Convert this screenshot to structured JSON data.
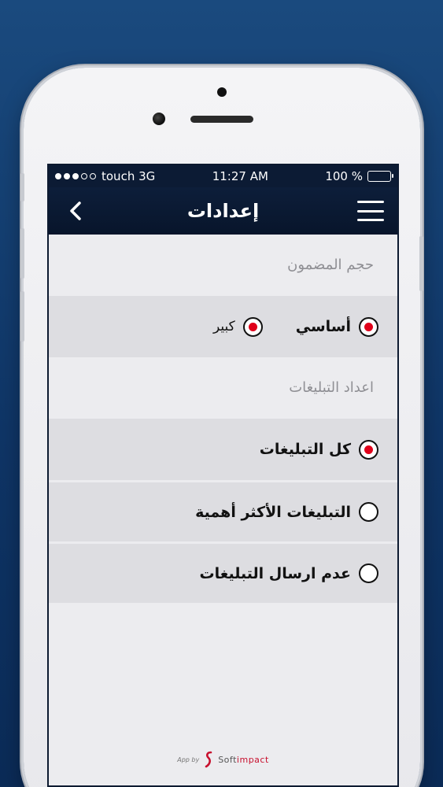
{
  "status_bar": {
    "signal_dots": [
      true,
      true,
      true,
      false,
      false
    ],
    "carrier": "touch 3G",
    "time": "11:27 AM",
    "battery_text": "100 %",
    "battery_level": 100
  },
  "navbar": {
    "title": "إعدادات",
    "back_icon": "chevron-left-icon",
    "menu_icon": "hamburger-menu-icon"
  },
  "content_size": {
    "header": "حجم المضمون",
    "options": [
      {
        "label": "أساسي",
        "selected": true
      },
      {
        "label": "كبير",
        "selected": true
      }
    ]
  },
  "notifications": {
    "header": "اعداد التبليغات",
    "options": [
      {
        "label": "كل التبليغات",
        "selected": true
      },
      {
        "label": "التبليغات الأكثر أهمية",
        "selected": false
      },
      {
        "label": "عدم ارسال التبليغات",
        "selected": false
      }
    ]
  },
  "footer": {
    "app_by": "App by",
    "brand_part1": "Soft",
    "brand_part2": "impact"
  },
  "colors": {
    "accent_red": "#e0001a",
    "navbar_bg": "#0c1b34",
    "row_bg": "#dddde1"
  }
}
